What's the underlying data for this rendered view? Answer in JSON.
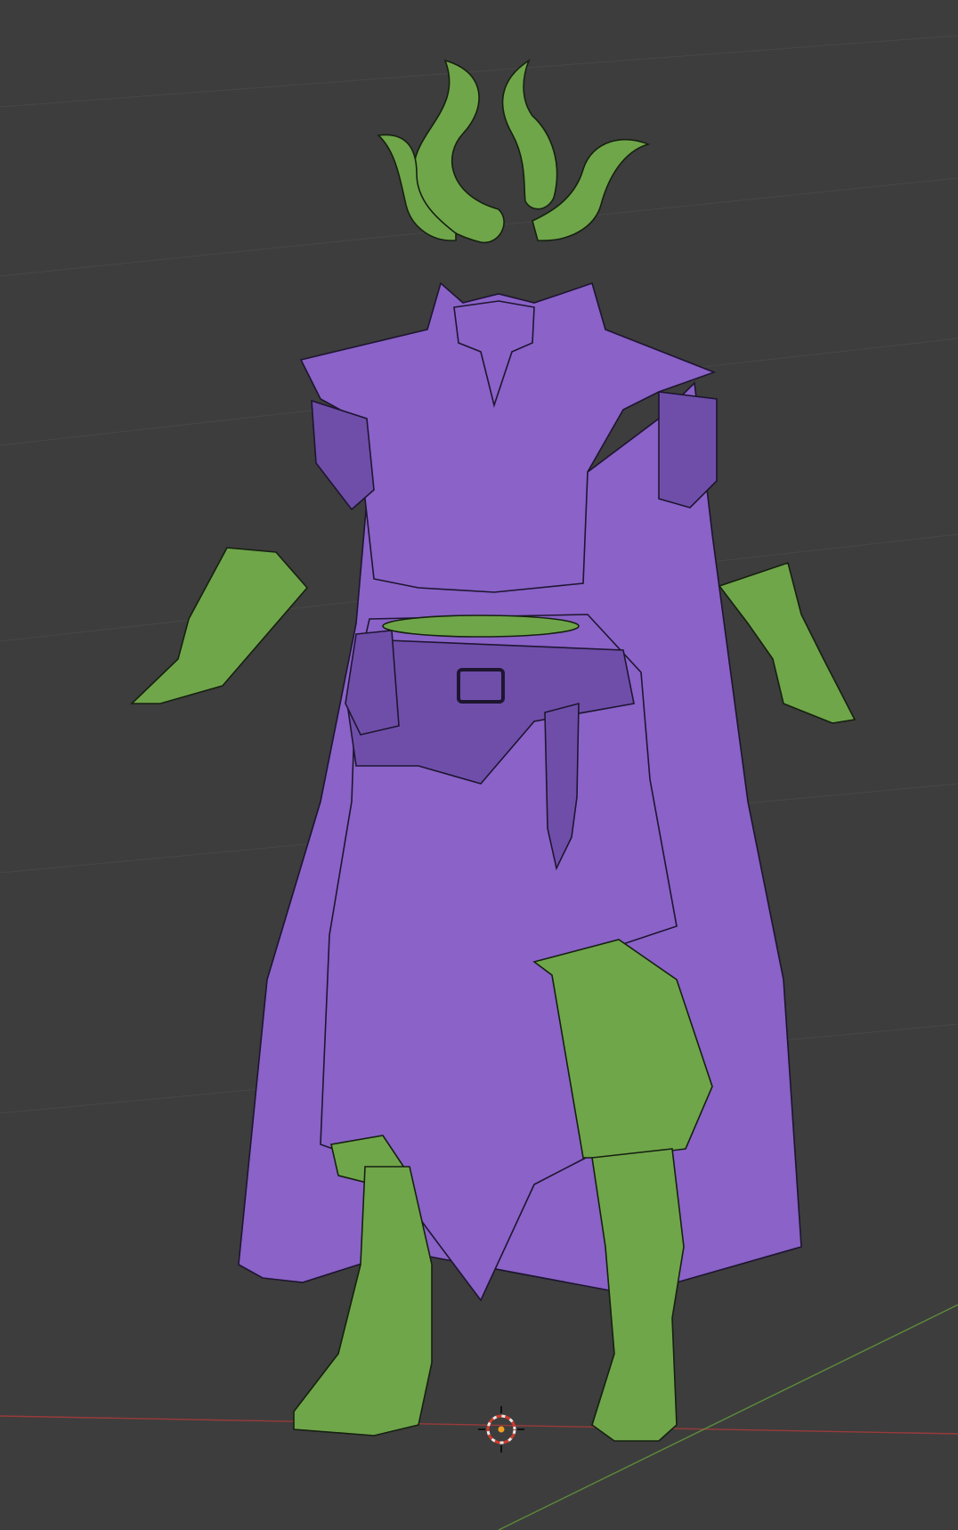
{
  "viewport": {
    "background_color": "#3d3d3d",
    "grid_color": "#474747",
    "x_axis_color": "#9a3a3a",
    "y_axis_color": "#5c8a3a"
  },
  "scene": {
    "objects": [
      {
        "name": "horns",
        "color": "#6fa64a"
      },
      {
        "name": "armor-top",
        "color": "#8a62c8"
      },
      {
        "name": "cape",
        "color": "#8a62c8"
      },
      {
        "name": "bracers",
        "color": "#6fa64a"
      },
      {
        "name": "skirt-and-belt",
        "color": "#8a62c8"
      },
      {
        "name": "trousers",
        "color": "#6fa64a"
      },
      {
        "name": "boots",
        "color": "#6fa64a"
      }
    ],
    "wireframe_color": "#1e1530",
    "cursor_icon": "3d-cursor-icon"
  }
}
